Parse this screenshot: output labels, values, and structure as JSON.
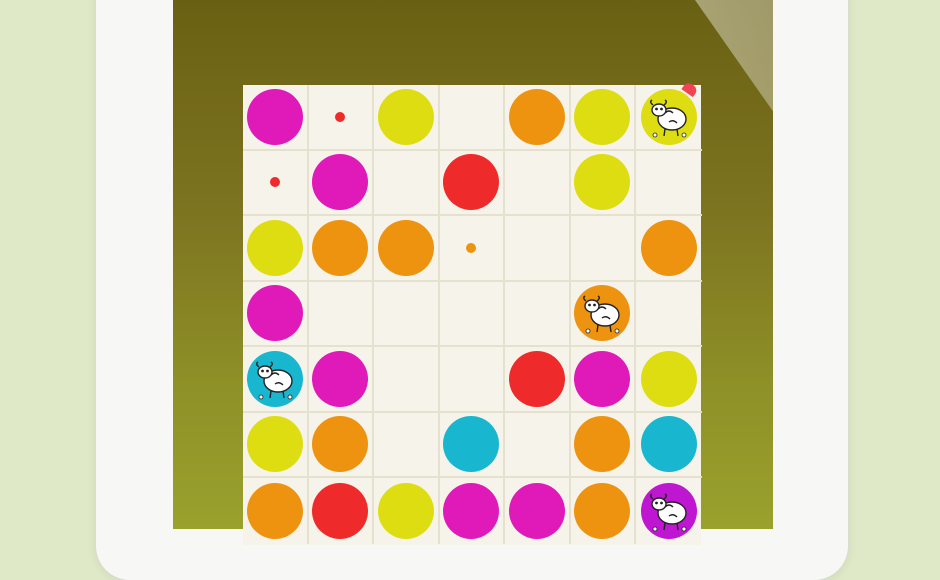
{
  "colors": {
    "pink": "#e01ab8",
    "yellow": "#dedd12",
    "orange": "#ee9310",
    "red": "#ee2a2a",
    "cyan": "#19b6cf",
    "purple": "#bf16d2",
    "empty": "#f6f3ea"
  },
  "board": [
    [
      {
        "type": "ball",
        "color": "pink"
      },
      {
        "type": "dot",
        "color": "red"
      },
      {
        "type": "ball",
        "color": "yellow"
      },
      {
        "type": "empty"
      },
      {
        "type": "ball",
        "color": "orange"
      },
      {
        "type": "ball",
        "color": "yellow"
      },
      {
        "type": "sheep",
        "color": "yellow"
      }
    ],
    [
      {
        "type": "dot",
        "color": "red"
      },
      {
        "type": "ball",
        "color": "pink"
      },
      {
        "type": "empty"
      },
      {
        "type": "ball",
        "color": "red"
      },
      {
        "type": "empty"
      },
      {
        "type": "ball",
        "color": "yellow"
      },
      {
        "type": "empty"
      }
    ],
    [
      {
        "type": "ball",
        "color": "yellow"
      },
      {
        "type": "ball",
        "color": "orange"
      },
      {
        "type": "ball",
        "color": "orange"
      },
      {
        "type": "dot",
        "color": "orange"
      },
      {
        "type": "empty"
      },
      {
        "type": "empty"
      },
      {
        "type": "ball",
        "color": "orange"
      }
    ],
    [
      {
        "type": "ball",
        "color": "pink"
      },
      {
        "type": "empty"
      },
      {
        "type": "empty"
      },
      {
        "type": "empty"
      },
      {
        "type": "empty"
      },
      {
        "type": "sheep",
        "color": "orange"
      },
      {
        "type": "empty"
      }
    ],
    [
      {
        "type": "sheep",
        "color": "cyan"
      },
      {
        "type": "ball",
        "color": "pink"
      },
      {
        "type": "empty"
      },
      {
        "type": "empty"
      },
      {
        "type": "ball",
        "color": "red"
      },
      {
        "type": "ball",
        "color": "pink"
      },
      {
        "type": "ball",
        "color": "yellow"
      }
    ],
    [
      {
        "type": "ball",
        "color": "yellow"
      },
      {
        "type": "ball",
        "color": "orange"
      },
      {
        "type": "empty"
      },
      {
        "type": "ball",
        "color": "cyan"
      },
      {
        "type": "empty"
      },
      {
        "type": "ball",
        "color": "orange"
      },
      {
        "type": "ball",
        "color": "cyan"
      }
    ],
    [
      {
        "type": "ball",
        "color": "orange"
      },
      {
        "type": "ball",
        "color": "red"
      },
      {
        "type": "ball",
        "color": "yellow"
      },
      {
        "type": "ball",
        "color": "pink"
      },
      {
        "type": "ball",
        "color": "pink"
      },
      {
        "type": "ball",
        "color": "orange"
      },
      {
        "type": "sheep",
        "color": "purple"
      }
    ]
  ]
}
